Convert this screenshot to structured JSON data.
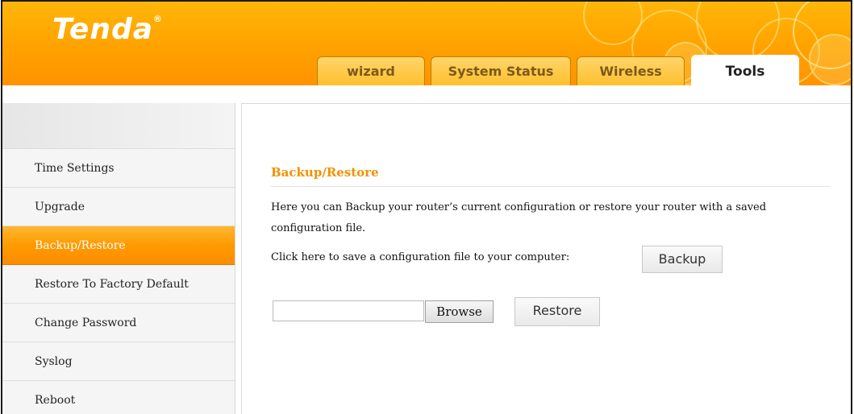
{
  "brand": {
    "logo_text": "Tenda",
    "logo_mark": "®",
    "accent": "#ff9c00"
  },
  "tabs": [
    {
      "label": "wizard",
      "active": false
    },
    {
      "label": "System Status",
      "active": false
    },
    {
      "label": "Wireless",
      "active": false
    },
    {
      "label": "Tools",
      "active": true
    }
  ],
  "sidebar": {
    "items": [
      {
        "label": "Time Settings",
        "active": false
      },
      {
        "label": "Upgrade",
        "active": false
      },
      {
        "label": "Backup/Restore",
        "active": true
      },
      {
        "label": "Restore To Factory Default",
        "active": false
      },
      {
        "label": "Change Password",
        "active": false
      },
      {
        "label": "Syslog",
        "active": false
      },
      {
        "label": "Reboot",
        "active": false
      }
    ]
  },
  "main": {
    "title": "Backup/Restore",
    "description": "Here you can Backup your router’s current configuration or restore your router with a saved configuration file.",
    "backup_prompt": "Click here to save a configuration file to your computer:",
    "backup_label": "Backup",
    "file_value": "",
    "browse_label": "Browse",
    "restore_label": "Restore"
  }
}
